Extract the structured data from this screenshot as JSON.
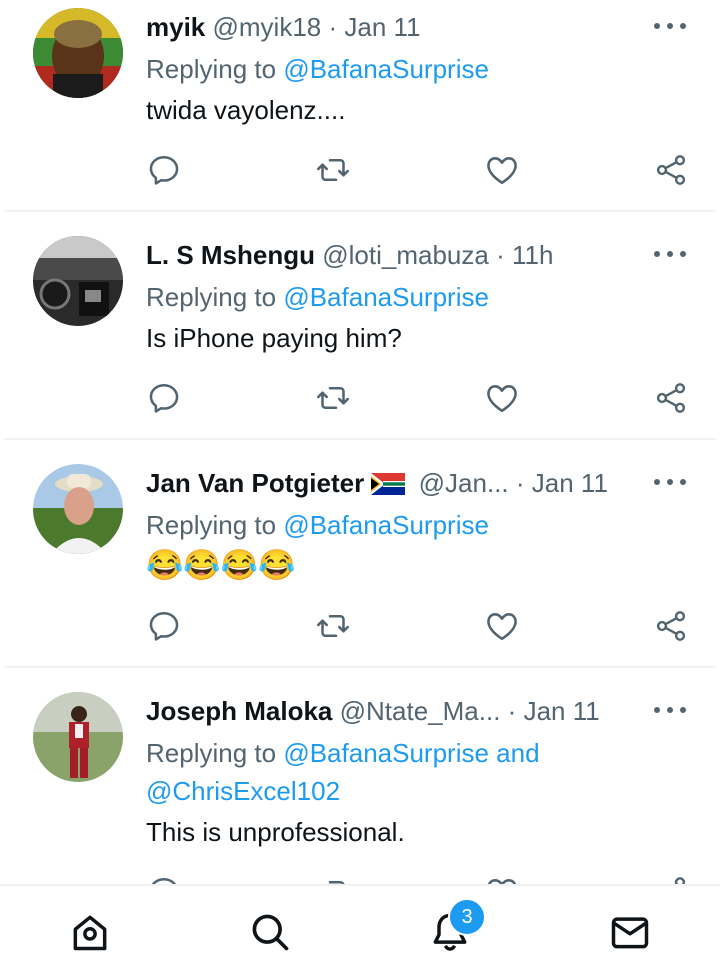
{
  "tweets": [
    {
      "display_name": "myik",
      "handle": "@myik18",
      "separator": "·",
      "time": "Jan 11",
      "reply_prefix": "Replying to",
      "reply_line1": "@BafanaSurprise",
      "reply_line2": "",
      "text": "twida vayolenz...."
    },
    {
      "display_name": "L. S Mshengu",
      "handle": "@loti_mabuza",
      "separator": "·",
      "time": "11h",
      "reply_prefix": "Replying to",
      "reply_line1": "@BafanaSurprise",
      "reply_line2": "",
      "text": "Is iPhone paying him?"
    },
    {
      "display_name": "Jan Van Potgieter",
      "handle": "@Jan...",
      "separator": "·",
      "time": "Jan 11",
      "reply_prefix": "Replying to",
      "reply_line1": "@BafanaSurprise",
      "reply_line2": "",
      "text": "😂😂😂😂",
      "flag": "south-africa-flag"
    },
    {
      "display_name": "Joseph Maloka",
      "handle": "@Ntate_Ma...",
      "separator": "·",
      "time": "Jan 11",
      "reply_prefix": "Replying to",
      "reply_line1": "@BafanaSurprise and",
      "reply_line2": "@ChrisExcel102",
      "text": "This is unprofessional."
    }
  ],
  "tab_bar": {
    "items": [
      "home-icon",
      "search-icon",
      "notifications-icon",
      "messages-icon"
    ],
    "notification_count": "3"
  },
  "colors": {
    "accent": "#1d9bf0",
    "text_primary": "#0f1419",
    "text_secondary": "#536471",
    "divider": "#eff3f4"
  }
}
